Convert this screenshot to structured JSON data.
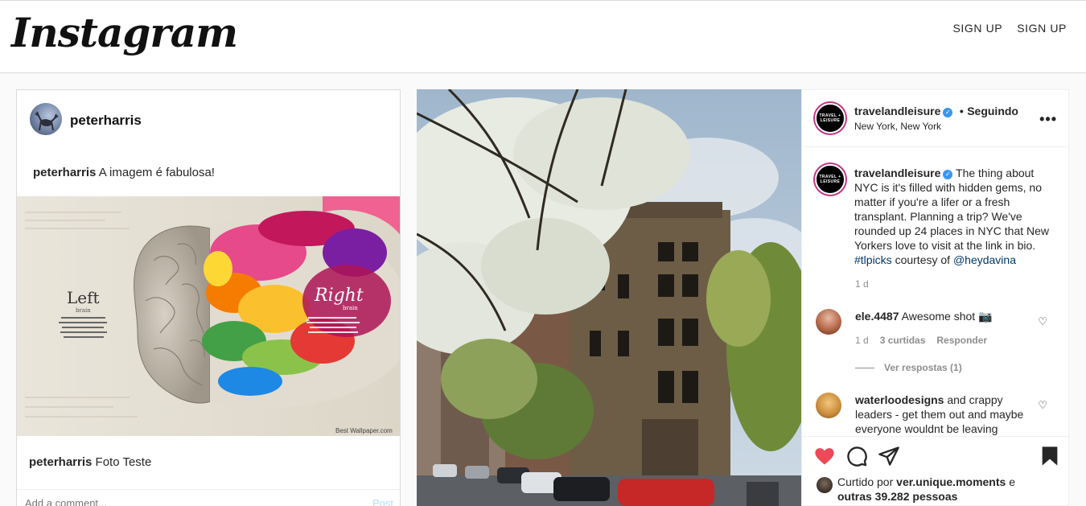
{
  "header": {
    "logo": "Instagram",
    "nav": [
      "SIGN UP",
      "SIGN UP"
    ]
  },
  "left_post": {
    "username": "peterharris",
    "caption_top": {
      "user": "peterharris",
      "text": " A imagem é fabulosa!"
    },
    "image": {
      "left_word": "Left",
      "left_sub": "brain",
      "right_word": "Right",
      "right_sub": "brain",
      "watermark": "Best Wallpaper.com"
    },
    "caption_bottom": {
      "user": "peterharris",
      "text": " Foto Teste"
    },
    "comment_placeholder": "Add a comment...",
    "post_label": "Post"
  },
  "modal": {
    "author": "travelandleisure",
    "separator": "•",
    "following": "Seguindo",
    "location": "New York, New York",
    "avatar_text": "TRAVEL + LEISURE",
    "caption": {
      "user": "travelandleisure",
      "text": " The thing about NYC is it's filled with hidden gems, no matter if you're a lifer or a fresh transplant. Planning a trip? We've rounded up 24 places in NYC that New Yorkers love to visit at the link in bio. ",
      "hashtag": "#tlpicks",
      "mid": " courtesy of ",
      "mention": "@heydavina",
      "time": "1 d"
    },
    "comments": [
      {
        "user": "ele.4487",
        "text": " Awesome shot 📷",
        "time": "1 d",
        "likes": "3 curtidas",
        "reply": "Responder",
        "view_replies": "Ver respostas (1)"
      },
      {
        "user": "waterloodesigns",
        "text": " and crappy leaders - get them out and maybe everyone wouldnt be leaving"
      }
    ],
    "likes": {
      "prefix": "Curtido por ",
      "user": "ver.unique.moments",
      "middle": " e",
      "others": "outras 39.282 pessoas"
    }
  },
  "colors": {
    "heart": "#ed4956",
    "link": "#00376b",
    "verified": "#3897f0"
  }
}
